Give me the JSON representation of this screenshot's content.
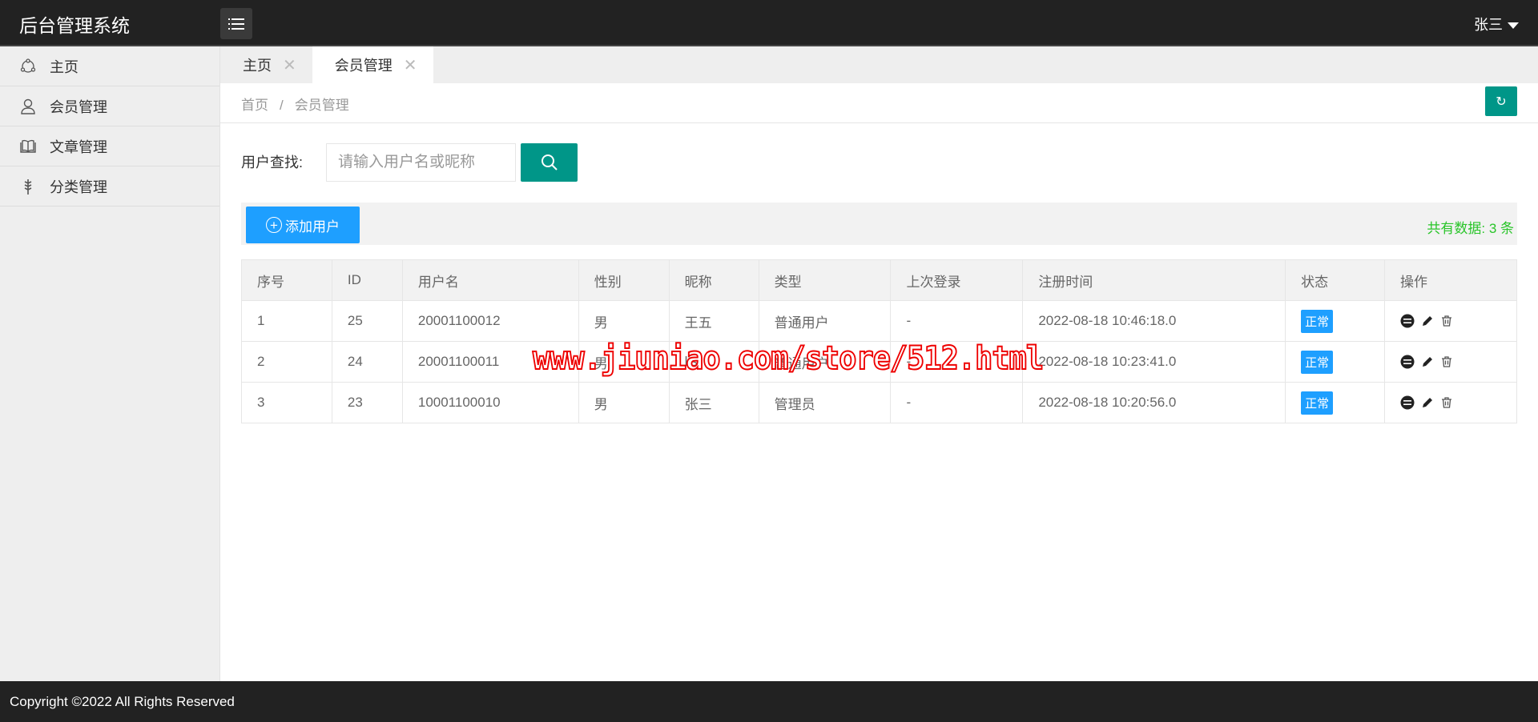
{
  "header": {
    "title": "后台管理系统",
    "user": "张三"
  },
  "sidebar": {
    "items": [
      {
        "label": "主页",
        "icon": "home-icon"
      },
      {
        "label": "会员管理",
        "icon": "user-icon"
      },
      {
        "label": "文章管理",
        "icon": "book-icon"
      },
      {
        "label": "分类管理",
        "icon": "category-icon"
      }
    ]
  },
  "tabs": [
    {
      "label": "主页"
    },
    {
      "label": "会员管理"
    }
  ],
  "breadcrumb": [
    "首页",
    "会员管理"
  ],
  "search": {
    "label": "用户查找:",
    "placeholder": "请输入用户名或昵称"
  },
  "toolbar": {
    "add_label": "添加用户",
    "total": "共有数据: 3 条"
  },
  "table": {
    "headers": [
      "序号",
      "ID",
      "用户名",
      "性别",
      "昵称",
      "类型",
      "上次登录",
      "注册时间",
      "状态",
      "操作"
    ],
    "rows": [
      [
        "1",
        "25",
        "20001100012",
        "男",
        "王五",
        "普通用户",
        "-",
        "2022-08-18 10:46:18.0",
        "正常"
      ],
      [
        "2",
        "24",
        "20001100011",
        "男",
        "lisi",
        "普通用户",
        "-",
        "2022-08-18 10:23:41.0",
        "正常"
      ],
      [
        "3",
        "23",
        "10001100010",
        "男",
        "张三",
        "管理员",
        "-",
        "2022-08-18 10:20:56.0",
        "正常"
      ]
    ]
  },
  "footer": "Copyright ©2022 All Rights Reserved",
  "watermark": "www.jiuniao.com/store/512.html",
  "colors": {
    "accent": "#009688",
    "primary": "#1e9fff",
    "success": "#2ac52a"
  }
}
